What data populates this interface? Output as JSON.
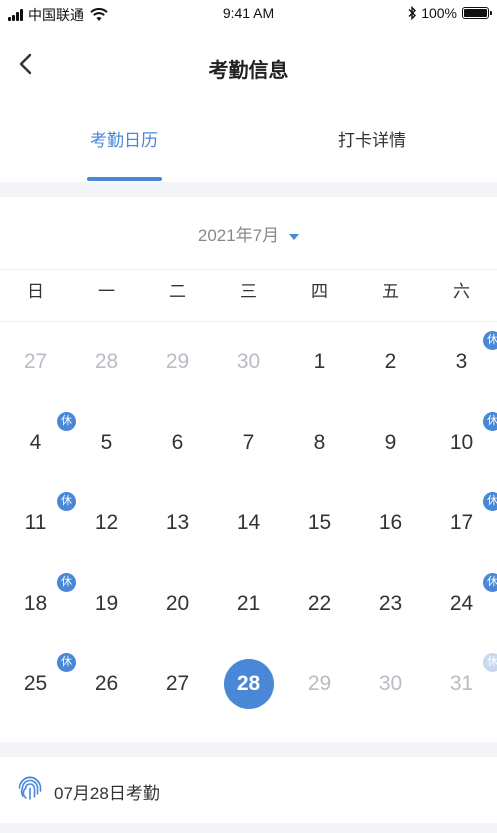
{
  "status_bar": {
    "carrier": "中国联通",
    "time": "9:41 AM",
    "battery": "100%",
    "battery_level": 1.0
  },
  "header": {
    "title": "考勤信息",
    "back_icon": "chevron-left-icon"
  },
  "tabs": [
    {
      "label": "考勤日历",
      "active": true
    },
    {
      "label": "打卡详情",
      "active": false
    }
  ],
  "calendar": {
    "month_label": "2021年7月",
    "weekdays": [
      "日",
      "一",
      "二",
      "三",
      "四",
      "五",
      "六"
    ],
    "rest_label": "休",
    "weeks": [
      [
        {
          "d": "27",
          "m": true
        },
        {
          "d": "28",
          "m": true
        },
        {
          "d": "29",
          "m": true
        },
        {
          "d": "30",
          "m": true
        },
        {
          "d": "1"
        },
        {
          "d": "2"
        },
        {
          "d": "3",
          "rest": true
        }
      ],
      [
        {
          "d": "4",
          "rest": true
        },
        {
          "d": "5"
        },
        {
          "d": "6"
        },
        {
          "d": "7"
        },
        {
          "d": "8"
        },
        {
          "d": "9"
        },
        {
          "d": "10",
          "rest": true
        }
      ],
      [
        {
          "d": "11",
          "rest": true
        },
        {
          "d": "12"
        },
        {
          "d": "13"
        },
        {
          "d": "14"
        },
        {
          "d": "15"
        },
        {
          "d": "16"
        },
        {
          "d": "17",
          "rest": true
        }
      ],
      [
        {
          "d": "18",
          "rest": true
        },
        {
          "d": "19"
        },
        {
          "d": "20"
        },
        {
          "d": "21"
        },
        {
          "d": "22"
        },
        {
          "d": "23"
        },
        {
          "d": "24",
          "rest": true
        }
      ],
      [
        {
          "d": "25",
          "rest": true
        },
        {
          "d": "26"
        },
        {
          "d": "27"
        },
        {
          "d": "28",
          "selected": true
        },
        {
          "d": "29",
          "m": true
        },
        {
          "d": "30",
          "m": true
        },
        {
          "d": "31",
          "m": true,
          "rest": true,
          "faded": true
        }
      ]
    ]
  },
  "record": {
    "icon": "fingerprint-icon",
    "title": "07月28日考勤"
  },
  "colors": {
    "accent": "#4a87d6",
    "muted": "#b8bcc4",
    "background": "#f4f5f8"
  }
}
